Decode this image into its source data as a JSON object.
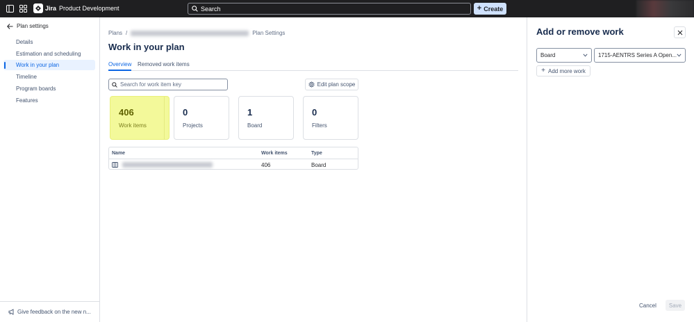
{
  "topbar": {
    "app_name": "Jira",
    "project_name": "Product Development",
    "search_placeholder": "Search",
    "create_label": "Create",
    "icons": [
      "sidebar-toggle-icon",
      "app-switcher-icon",
      "jira-logo-icon",
      "search-icon",
      "plus-icon"
    ]
  },
  "sidebar": {
    "back_label": "Plan settings",
    "items": [
      {
        "label": "Details"
      },
      {
        "label": "Estimation and scheduling"
      },
      {
        "label": "Work in your plan"
      },
      {
        "label": "Timeline"
      },
      {
        "label": "Program boards"
      },
      {
        "label": "Features"
      }
    ],
    "active_item": "Work in your plan",
    "feedback_label": "Give feedback on the new n..."
  },
  "main": {
    "breadcrumb": {
      "root": "Plans",
      "separator": "/",
      "current": "Plan Settings"
    },
    "title": "Work in your plan",
    "tabs": [
      {
        "label": "Overview"
      },
      {
        "label": "Removed work items"
      }
    ],
    "active_tab": "Overview",
    "search_placeholder": "Search for work item key",
    "edit_scope_label": "Edit plan scope",
    "cards": [
      {
        "value": "406",
        "label": "Work items"
      },
      {
        "value": "0",
        "label": "Projects"
      },
      {
        "value": "1",
        "label": "Board"
      },
      {
        "value": "0",
        "label": "Filters"
      }
    ],
    "table": {
      "headers": [
        "Name",
        "Work items",
        "Type"
      ],
      "rows": [
        {
          "work_items": "406",
          "type": "Board"
        }
      ]
    }
  },
  "panel": {
    "title": "Add or remove work",
    "source_type": "Board",
    "source_value": "1715-AENTRS Series A Open...",
    "add_more_label": "Add more work",
    "cancel_label": "Cancel",
    "save_label": "Save"
  },
  "colors": {
    "topbar_bg": "#1F1F21",
    "accent": "#0C66E4",
    "create_bg": "#CFE1FD",
    "highlight": "#F3F99A"
  }
}
